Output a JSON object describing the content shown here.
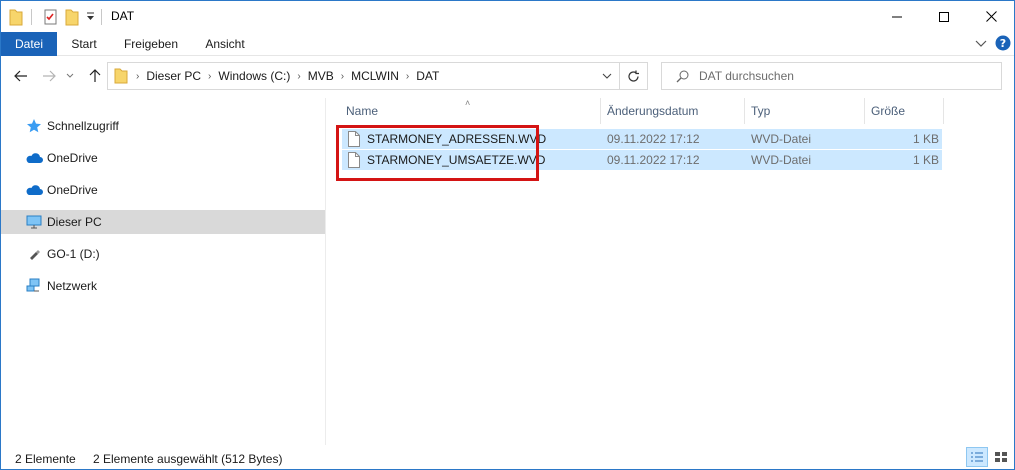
{
  "window": {
    "title": "DAT"
  },
  "ribbon": {
    "tabs": [
      {
        "label": "Datei",
        "active": true
      },
      {
        "label": "Start",
        "active": false
      },
      {
        "label": "Freigeben",
        "active": false
      },
      {
        "label": "Ansicht",
        "active": false
      }
    ]
  },
  "address": {
    "crumbs": [
      "Dieser PC",
      "Windows (C:)",
      "MVB",
      "MCLWIN",
      "DAT"
    ]
  },
  "search": {
    "placeholder": "DAT durchsuchen"
  },
  "nav": {
    "items": [
      {
        "label": "Schnellzugriff",
        "icon": "star-icon",
        "selected": false
      },
      {
        "label": "OneDrive",
        "icon": "cloud-icon",
        "selected": false
      },
      {
        "label": "OneDrive",
        "icon": "cloud-icon",
        "selected": false
      },
      {
        "label": "Dieser PC",
        "icon": "monitor-icon",
        "selected": true
      },
      {
        "label": "GO-1 (D:)",
        "icon": "usb-drive-icon",
        "selected": false
      },
      {
        "label": "Netzwerk",
        "icon": "network-icon",
        "selected": false
      }
    ]
  },
  "columns": {
    "name": "Name",
    "date": "Änderungsdatum",
    "type": "Typ",
    "size": "Größe"
  },
  "files": [
    {
      "name": "STARMONEY_ADRESSEN.WVD",
      "date": "09.11.2022 17:12",
      "type": "WVD-Datei",
      "size": "1 KB",
      "selected": true
    },
    {
      "name": "STARMONEY_UMSAETZE.WVD",
      "date": "09.11.2022 17:12",
      "type": "WVD-Datei",
      "size": "1 KB",
      "selected": true
    }
  ],
  "status": {
    "count": "2 Elemente",
    "selection": "2 Elemente ausgewählt (512 Bytes)"
  },
  "colors": {
    "accent": "#1a63b8",
    "selection": "#cce8ff",
    "highlight": "#d41414",
    "folder": "#f7d56b"
  }
}
